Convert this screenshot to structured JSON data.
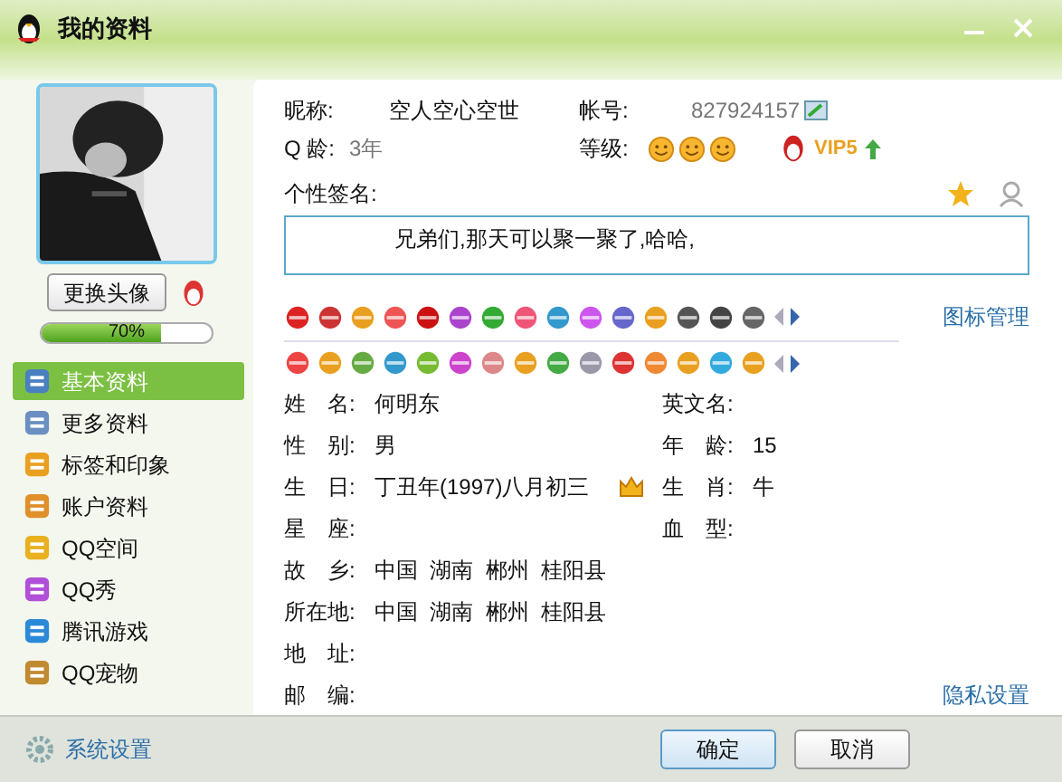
{
  "window": {
    "title": "我的资料"
  },
  "avatar": {
    "change_button": "更换头像",
    "progress": {
      "level": 0.7,
      "reading": "70%"
    }
  },
  "sidebar": {
    "items": [
      {
        "label": "基本资料",
        "selected": true
      },
      {
        "label": "更多资料",
        "selected": false
      },
      {
        "label": "标签和印象",
        "selected": false
      },
      {
        "label": "账户资料",
        "selected": false
      },
      {
        "label": "QQ空间",
        "selected": false
      },
      {
        "label": "QQ秀",
        "selected": false
      },
      {
        "label": "腾讯游戏",
        "selected": false
      },
      {
        "label": "QQ宠物",
        "selected": false
      }
    ],
    "settings": "系统设置"
  },
  "header": {
    "nickname_label": "昵称:",
    "nickname": "空人空心空世",
    "account_label": "帐号:",
    "account": "827924157",
    "qage_label": "Q 龄:",
    "qage": "3年",
    "level_label": "等级:",
    "vip": "VIP5",
    "signature_label": "个性签名:",
    "signature": "兄弟们,那天可以聚一聚了,哈哈,"
  },
  "icon_manage_link": "图标管理",
  "fields": [
    {
      "left": {
        "label": "姓　名:",
        "value": "何明东"
      },
      "right": {
        "label": "英文名:"
      }
    },
    {
      "left": {
        "label": "性　别:",
        "value": "男"
      },
      "right": {
        "label": "年　龄:",
        "value": "15"
      }
    },
    {
      "left": {
        "label": "生　日:",
        "value": "丁丑年(1997)八月初三",
        "crown": true
      },
      "right": {
        "label": "生　肖:",
        "value": "牛"
      }
    },
    {
      "left": {
        "label": "星　座:"
      },
      "right": {
        "label": "血　型:"
      }
    },
    {
      "left": {
        "label": "故　乡:",
        "value": "中国  湖南  郴州  桂阳县"
      }
    },
    {
      "left": {
        "label": "所在地:",
        "value": "中国  湖南  郴州  桂阳县"
      }
    },
    {
      "left": {
        "label": "地　址:"
      }
    },
    {
      "left": {
        "label": "邮　编:"
      }
    }
  ],
  "privacy_link": "隐私设置",
  "buttons": [
    "确定",
    "取消"
  ]
}
